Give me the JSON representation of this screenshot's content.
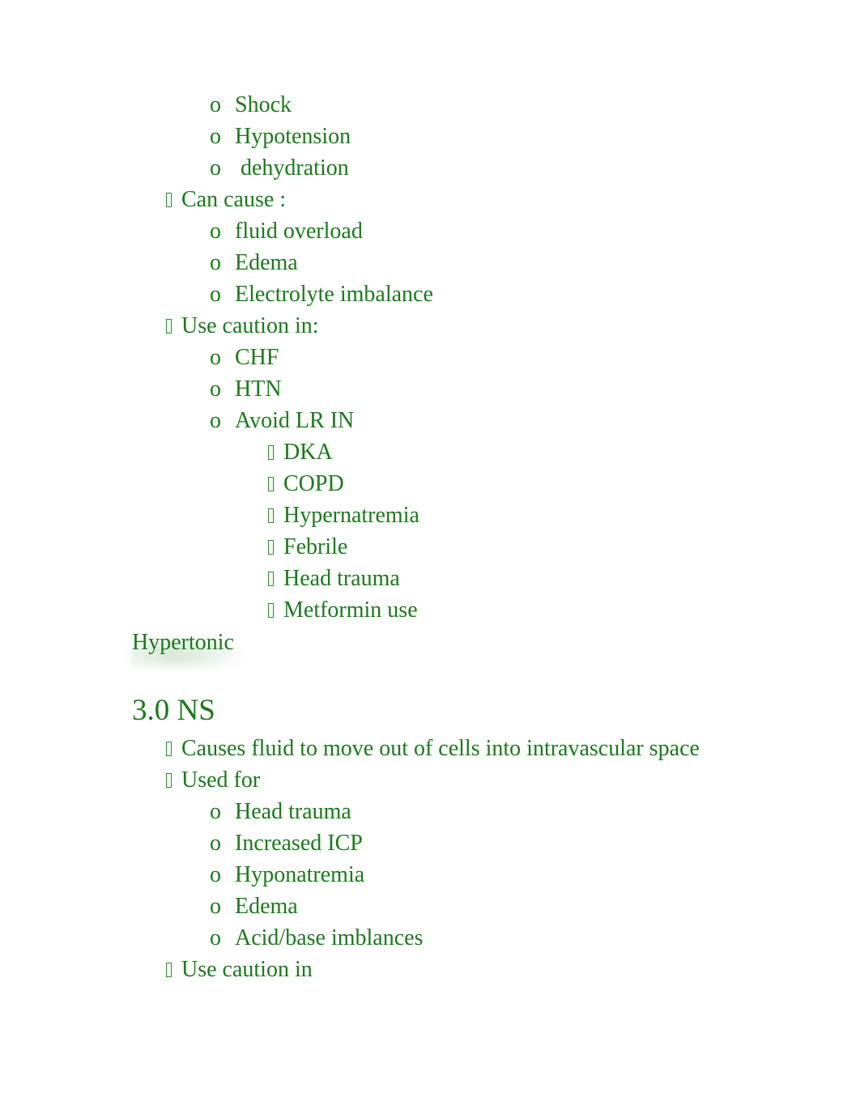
{
  "document": {
    "text_color": "#1a7a1a",
    "bullet_color": "#2e8b2e",
    "background": "#ffffff",
    "markers": {
      "level2": "tofu-box",
      "level3": "o",
      "level4": "tofu-box"
    }
  },
  "top_section": {
    "items": [
      {
        "level": 3,
        "text": "Shock"
      },
      {
        "level": 3,
        "text": "Hypotension"
      },
      {
        "level": 3,
        "text": " dehydration"
      },
      {
        "level": 2,
        "text": "Can cause :"
      },
      {
        "level": 3,
        "text": "fluid overload"
      },
      {
        "level": 3,
        "text": "Edema"
      },
      {
        "level": 3,
        "text": "Electrolyte imbalance"
      },
      {
        "level": 2,
        "text": "Use caution in:"
      },
      {
        "level": 3,
        "text": "CHF"
      },
      {
        "level": 3,
        "text": "HTN"
      },
      {
        "level": 3,
        "text": "Avoid LR IN"
      },
      {
        "level": 4,
        "text": "DKA"
      },
      {
        "level": 4,
        "text": "COPD"
      },
      {
        "level": 4,
        "text": "Hypernatremia"
      },
      {
        "level": 4,
        "text": "Febrile"
      },
      {
        "level": 4,
        "text": "Head trauma"
      },
      {
        "level": 4,
        "text": "Metformin use"
      }
    ]
  },
  "section_heading": {
    "text": "Hypertonic"
  },
  "ns_section": {
    "title": "3.0 NS",
    "items": [
      {
        "level": 2,
        "text": "Causes fluid to move out of cells into intravascular space"
      },
      {
        "level": 2,
        "text": "Used for"
      },
      {
        "level": 3,
        "text": "Head trauma"
      },
      {
        "level": 3,
        "text": "Increased ICP"
      },
      {
        "level": 3,
        "text": "Hyponatremia"
      },
      {
        "level": 3,
        "text": "Edema"
      },
      {
        "level": 3,
        "text": "Acid/base imblances"
      },
      {
        "level": 2,
        "text": "Use caution in"
      }
    ]
  }
}
